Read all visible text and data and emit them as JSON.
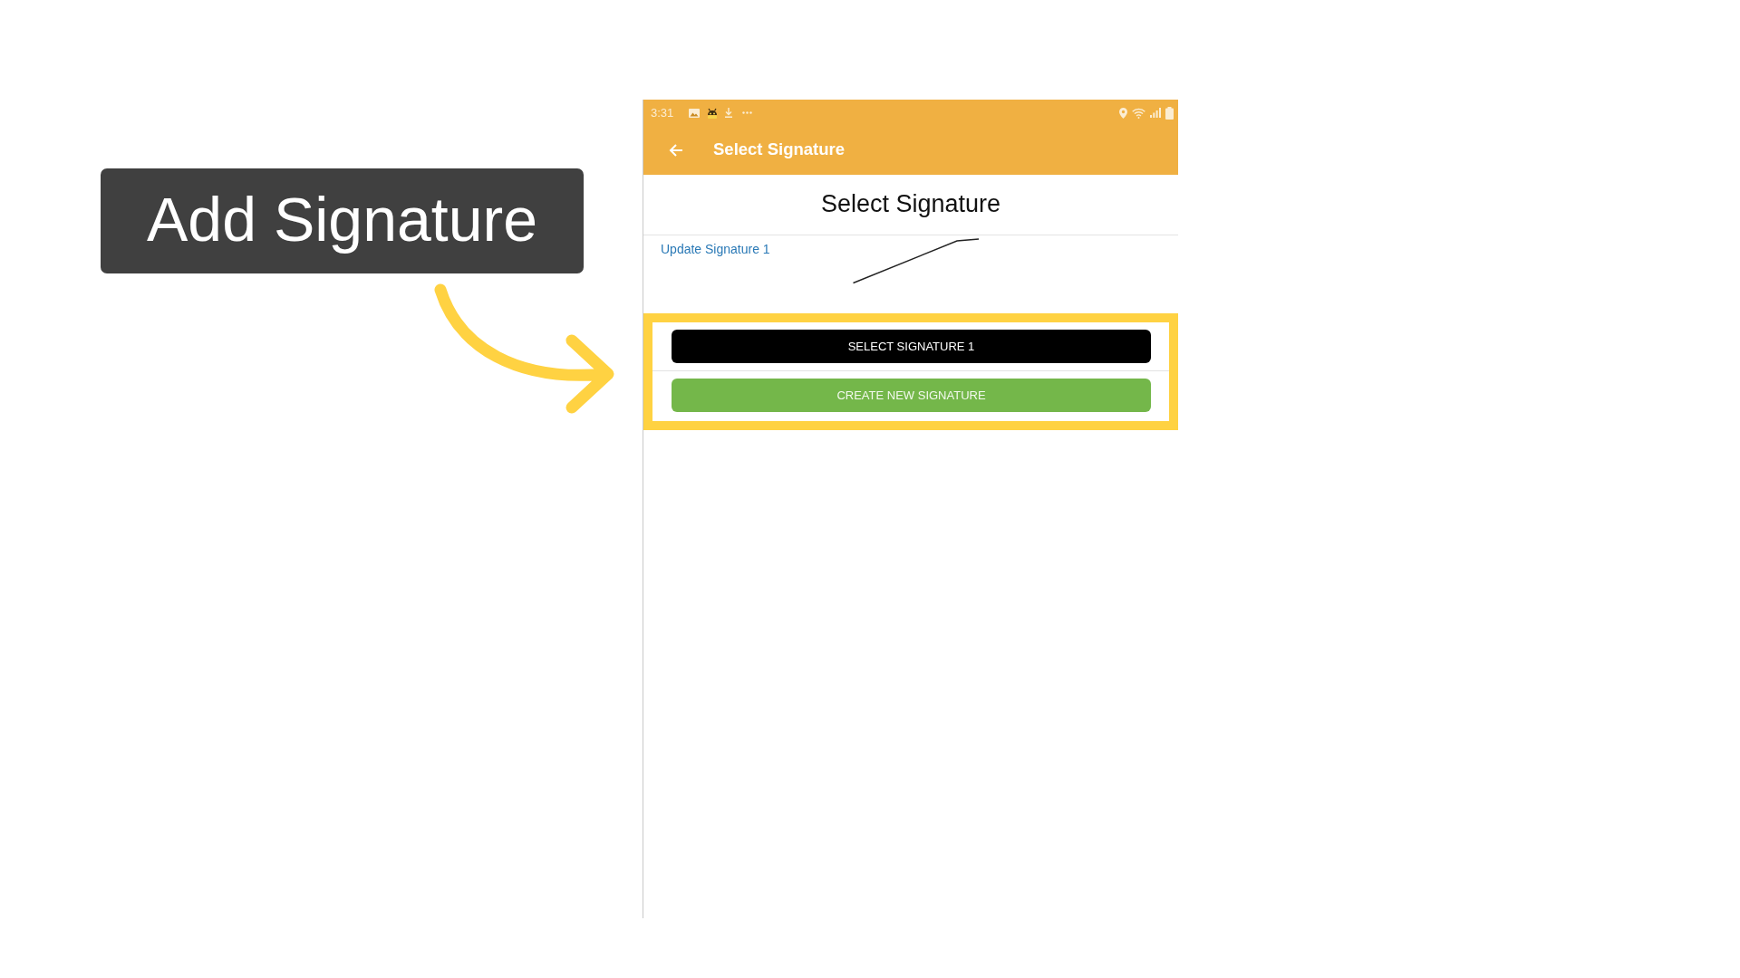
{
  "callout": {
    "text": "Add Signature"
  },
  "phone": {
    "status_bar": {
      "time": "3:31"
    },
    "app_bar": {
      "title": "Select Signature"
    },
    "heading": "Select Signature",
    "signatures": [
      {
        "link": "Update Signature 1"
      }
    ],
    "actions": {
      "highlighted": true,
      "buttons": [
        {
          "label": "SELECT SIGNATURE 1",
          "kind": "select"
        },
        {
          "label": "CREATE NEW SIGNATURE",
          "kind": "create"
        }
      ]
    }
  }
}
